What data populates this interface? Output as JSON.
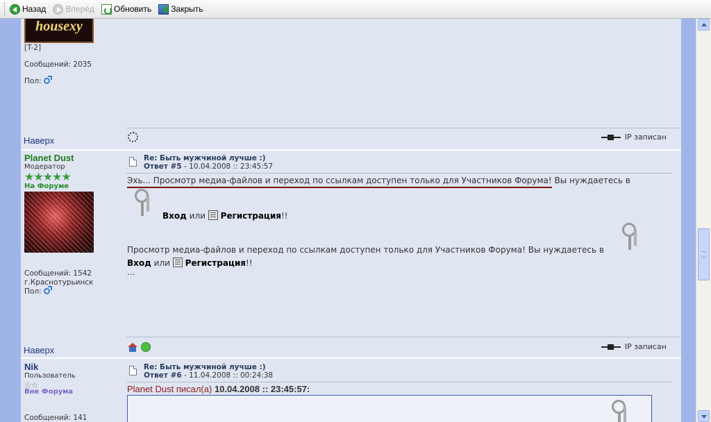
{
  "toolbar": {
    "back": "Назад",
    "forward": "Вперёд",
    "refresh": "Обновить",
    "close": "Закрыть"
  },
  "post_prev": {
    "avatar_text": "housexy",
    "group": "[T-2]",
    "messages": "Сообщений: 2035",
    "gender": "Пол:",
    "top_link": "Наверх",
    "ip": "IP записан"
  },
  "post5": {
    "author": "Planet Dust",
    "role": "Модератор",
    "stars": "★★★★★",
    "status": "На Форуме",
    "messages": "Сообщений: 1542",
    "city": "г.Краснотурьинск",
    "gender": "Пол:",
    "subject": "Re: Быть мужчиной лучше :)",
    "answer_label": "Ответ #5",
    "date": " - 10.04.2008 :: 23:45:57",
    "line1_a": "Эхь... Просмотр медиа-файлов и переход по ссылкам доступен только для Участников Форума!",
    "line1_b": " Вы нуждаетесь в",
    "login": "Вход",
    "or": " или ",
    "register": "Регистрация",
    "excl": "!!",
    "line2": "Просмотр медиа-файлов и переход по ссылкам доступен только для Участников Форума!  Вы нуждаетесь в",
    "ellipsis": "...",
    "top_link": "Наверх",
    "ip": "IP записан"
  },
  "post6": {
    "author": "Nik",
    "role": "Пользователь",
    "stars": "☆☆",
    "status": "Вне Форума",
    "messages": "Сообщений: 141",
    "subject": "Re: Быть мужчиной лучше :)",
    "answer_label": "Ответ #6",
    "date": " - 11.04.2008 :: 00:24:38",
    "quote_author": "Planet Dust писал(а) ",
    "quote_date": "10.04.2008 :: 23:45:57:"
  }
}
